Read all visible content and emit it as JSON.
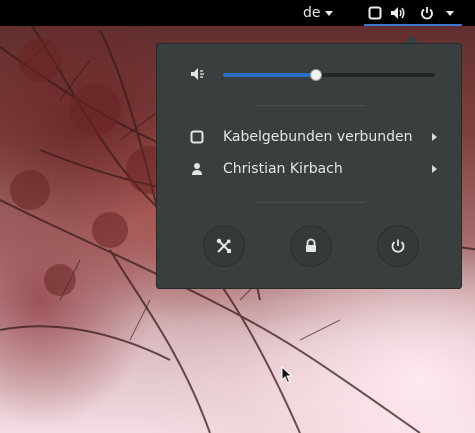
{
  "top_bar": {
    "language": "de",
    "status_icons": [
      "network-wired-icon",
      "volume-icon",
      "power-icon"
    ]
  },
  "system_menu": {
    "volume": {
      "level": 0.44,
      "icon": "volume-low-icon"
    },
    "items": [
      {
        "label": "Kabelgebunden verbunden",
        "icon": "network-wired-icon"
      },
      {
        "label": "Christian Kirbach",
        "icon": "user-icon"
      }
    ],
    "actions": [
      "settings-icon",
      "lock-icon",
      "power-off-icon"
    ]
  },
  "colors": {
    "accent": "#2b6fc5",
    "menu_bg": "#393f3f",
    "top_bar": "#000000"
  }
}
